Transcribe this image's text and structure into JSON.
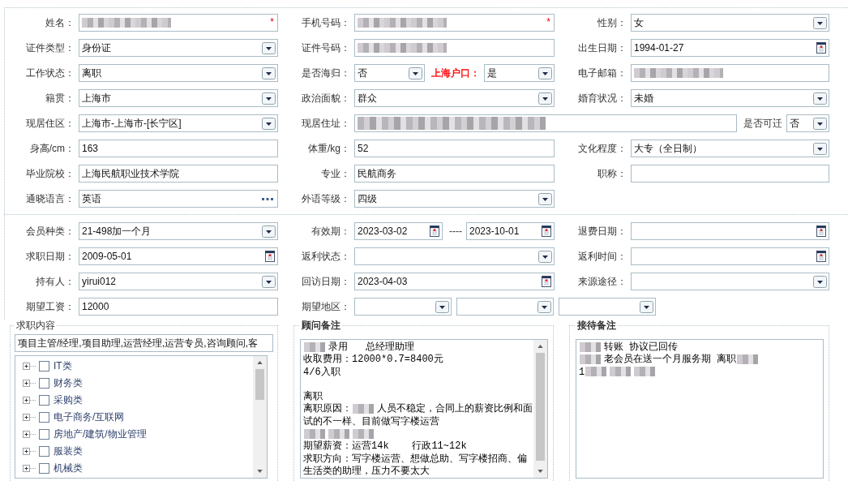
{
  "personal_info": {
    "rows": [
      {
        "groups": [
          {
            "label": "姓名：",
            "controls": [
              {
                "kind": "text",
                "redacted": true,
                "required_mark": "*"
              }
            ]
          },
          {
            "label": "手机号码：",
            "controls": [
              {
                "kind": "text",
                "redacted": true,
                "required_mark": "*"
              }
            ]
          },
          {
            "label": "性别：",
            "controls": [
              {
                "kind": "select",
                "value": "女"
              }
            ]
          }
        ]
      },
      {
        "groups": [
          {
            "label": "证件类型：",
            "controls": [
              {
                "kind": "select",
                "value": "身份证"
              }
            ]
          },
          {
            "label": "证件号码：",
            "controls": [
              {
                "kind": "text",
                "redacted": true
              }
            ]
          },
          {
            "label": "出生日期：",
            "controls": [
              {
                "kind": "date",
                "value": "1994-01-27"
              }
            ]
          }
        ]
      },
      {
        "groups": [
          {
            "label": "工作状态：",
            "controls": [
              {
                "kind": "select",
                "value": "离职"
              }
            ]
          },
          {
            "label": "是否海归：",
            "controls": [
              {
                "kind": "select",
                "value": "否"
              },
              {
                "kind": "label",
                "text": "上海户口：",
                "color": "#ff0000"
              },
              {
                "kind": "select",
                "value": "是"
              }
            ]
          },
          {
            "label": "电子邮箱：",
            "controls": [
              {
                "kind": "text",
                "redacted": true
              }
            ]
          }
        ]
      },
      {
        "groups": [
          {
            "label": "籍贯：",
            "controls": [
              {
                "kind": "select",
                "value": "上海市"
              }
            ]
          },
          {
            "label": "政治面貌：",
            "controls": [
              {
                "kind": "select",
                "value": "群众"
              }
            ]
          },
          {
            "label": "婚育状况：",
            "controls": [
              {
                "kind": "select",
                "value": "未婚"
              }
            ]
          }
        ]
      },
      {
        "groups": [
          {
            "label": "现居住区：",
            "controls": [
              {
                "kind": "select",
                "value": "上海市-上海市-[长宁区]"
              }
            ]
          },
          {
            "label": "现居住址：",
            "controls": [
              {
                "kind": "text",
                "redacted": true
              },
              {
                "kind": "label",
                "text": "是否可迁"
              },
              {
                "kind": "select",
                "value": "否"
              }
            ]
          }
        ]
      },
      {
        "groups": [
          {
            "label": "身高/cm：",
            "controls": [
              {
                "kind": "text",
                "redacted": false,
                "value": "163"
              }
            ]
          },
          {
            "label": "体重/kg：",
            "controls": [
              {
                "kind": "text",
                "redacted": false,
                "value": "52"
              }
            ]
          },
          {
            "label": "文化程度：",
            "controls": [
              {
                "kind": "select",
                "value": "大专（全日制）"
              }
            ]
          }
        ]
      },
      {
        "groups": [
          {
            "label": "毕业院校：",
            "controls": [
              {
                "kind": "text",
                "redacted": false,
                "value": "上海民航职业技术学院"
              }
            ]
          },
          {
            "label": "专业：",
            "controls": [
              {
                "kind": "text",
                "redacted": false,
                "value": "民航商务"
              }
            ]
          },
          {
            "label": "职称：",
            "controls": [
              {
                "kind": "text",
                "redacted": false
              }
            ]
          }
        ]
      },
      {
        "groups": [
          {
            "label": "通晓语言：",
            "controls": [
              {
                "kind": "picker",
                "value": "英语"
              }
            ]
          },
          {
            "label": "外语等级：",
            "controls": [
              {
                "kind": "select",
                "value": "四级"
              }
            ]
          }
        ]
      }
    ]
  },
  "membership": {
    "rows": [
      {
        "groups": [
          {
            "label": "会员种类：",
            "controls": [
              {
                "kind": "select",
                "value": "21-498加一个月"
              }
            ]
          },
          {
            "label": "有效期：",
            "controls": [
              {
                "kind": "date",
                "value": "2023-03-02"
              },
              {
                "kind": "label",
                "text": "----"
              },
              {
                "kind": "date",
                "value": "2023-10-01"
              }
            ]
          },
          {
            "label": "退费日期：",
            "controls": [
              {
                "kind": "date"
              }
            ]
          }
        ]
      },
      {
        "groups": [
          {
            "label": "求职日期：",
            "controls": [
              {
                "kind": "date",
                "value": "2009-05-01"
              }
            ]
          },
          {
            "label": "返利状态：",
            "controls": [
              {
                "kind": "select"
              }
            ]
          },
          {
            "label": "返利时间：",
            "controls": [
              {
                "kind": "date"
              }
            ]
          }
        ]
      },
      {
        "groups": [
          {
            "label": "持有人：",
            "controls": [
              {
                "kind": "select",
                "value": "yirui012"
              }
            ]
          },
          {
            "label": "回访日期：",
            "controls": [
              {
                "kind": "date",
                "value": "2023-04-03"
              }
            ]
          },
          {
            "label": "来源途径：",
            "controls": [
              {
                "kind": "select"
              }
            ]
          }
        ]
      },
      {
        "groups": [
          {
            "label": "期望工资：",
            "controls": [
              {
                "kind": "text",
                "redacted": false,
                "value": "12000"
              }
            ]
          },
          {
            "label": "期望地区：",
            "controls": [
              {
                "kind": "select"
              },
              {
                "kind": "select"
              },
              {
                "kind": "select"
              }
            ]
          }
        ]
      }
    ]
  },
  "panels": [
    {
      "kind": "categories",
      "legend": "求职内容",
      "bold": false,
      "scrollbar": true,
      "selected_text": "项目主管/经理,项目助理,运营经理,运营专员,咨询顾问,客",
      "categories": [
        {
          "label": "IT类",
          "expanded": false,
          "checked": false
        },
        {
          "label": "财务类",
          "expanded": false,
          "checked": false
        },
        {
          "label": "采购类",
          "expanded": false,
          "checked": false
        },
        {
          "label": "电子商务/互联网",
          "expanded": false,
          "checked": false
        },
        {
          "label": "房地产/建筑/物业管理",
          "expanded": false,
          "checked": false
        },
        {
          "label": "服装类",
          "expanded": false,
          "checked": false
        },
        {
          "label": "机械类",
          "expanded": false,
          "checked": false
        }
      ]
    },
    {
      "kind": "notes",
      "legend": "顾问备注",
      "bold": true,
      "scrollbar": true,
      "lines": [
        {
          "kind": "text",
          "parts": [
            {
              "kind": "blur"
            },
            {
              "kind": "text",
              "text": "录用   总经理助理"
            }
          ]
        },
        {
          "kind": "text",
          "parts": [
            {
              "kind": "text",
              "text": "收取费用：12000*0.7=8400元"
            }
          ]
        },
        {
          "kind": "text",
          "parts": [
            {
              "kind": "text",
              "text": "4/6入职"
            }
          ]
        },
        {
          "kind": "blank"
        },
        {
          "kind": "text",
          "parts": [
            {
              "kind": "text",
              "text": "离职"
            }
          ]
        },
        {
          "kind": "text",
          "parts": [
            {
              "kind": "text",
              "text": "离职原因："
            },
            {
              "kind": "blur"
            },
            {
              "kind": "text",
              "text": "人员不稳定，合同上的薪资比例和面"
            }
          ]
        },
        {
          "kind": "text",
          "parts": [
            {
              "kind": "text",
              "text": "试的不一样、目前做写字楼运营"
            }
          ]
        },
        {
          "kind": "text",
          "parts": [
            {
              "kind": "blur"
            },
            {
              "kind": "blur"
            },
            {
              "kind": "blur"
            }
          ]
        },
        {
          "kind": "text",
          "parts": [
            {
              "kind": "text",
              "text": "期望薪资：运营14k    行政11~12k"
            }
          ]
        },
        {
          "kind": "text",
          "parts": [
            {
              "kind": "text",
              "text": "求职方向：写字楼运营、想做总助、写字楼招商、偏"
            }
          ]
        },
        {
          "kind": "text",
          "parts": [
            {
              "kind": "text",
              "text": "生活类的助理，压力不要太大"
            }
          ]
        }
      ]
    },
    {
      "kind": "notes",
      "legend": "接待备注",
      "bold": true,
      "scrollbar": false,
      "lines": [
        {
          "kind": "text",
          "parts": [
            {
              "kind": "blur"
            },
            {
              "kind": "text",
              "text": "转账 协议已回传"
            }
          ]
        },
        {
          "kind": "text",
          "parts": [
            {
              "kind": "blur"
            },
            {
              "kind": "text",
              "text": "老会员在送一个月服务期 离职"
            },
            {
              "kind": "blur"
            }
          ]
        },
        {
          "kind": "text",
          "parts": [
            {
              "kind": "text",
              "text": "1"
            },
            {
              "kind": "blur"
            },
            {
              "kind": "blur"
            },
            {
              "kind": "blur"
            }
          ]
        }
      ]
    }
  ]
}
